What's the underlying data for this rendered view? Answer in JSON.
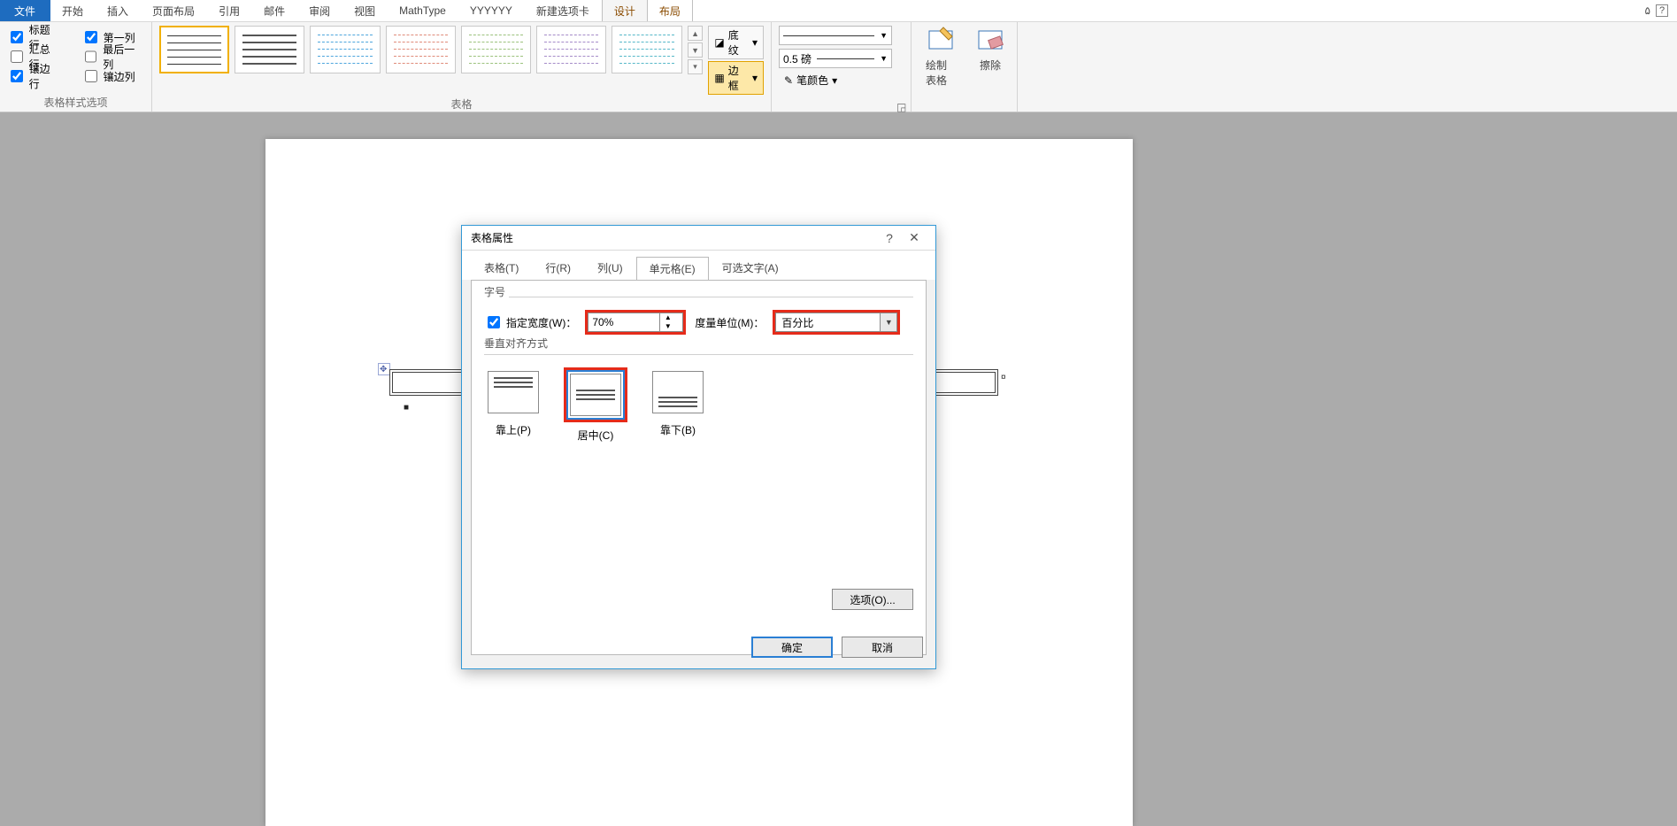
{
  "menu": {
    "file": "文件",
    "home": "开始",
    "insert": "插入",
    "layout": "页面布局",
    "ref": "引用",
    "mail": "邮件",
    "review": "审阅",
    "view": "视图",
    "math": "MathType",
    "y": "YYYYYY",
    "newtab": "新建选项卡",
    "design": "设计",
    "tlayout": "布局"
  },
  "styleopts": {
    "header_row": "标题行",
    "first_col": "第一列",
    "total_row": "汇总行",
    "last_col": "最后一列",
    "banded_row": "镶边行",
    "banded_col": "镶边列",
    "group_label": "表格样式选项"
  },
  "styles_group": "表格",
  "borders": {
    "shading": "底纹",
    "border": "边框"
  },
  "borders2": {
    "weight": "0.5 磅",
    "pencolor": "笔颜色"
  },
  "draw": {
    "draw": "绘制表格",
    "erase": "擦除"
  },
  "dialog": {
    "title": "表格属性",
    "help": "?",
    "close": "✕",
    "tabs": {
      "table": "表格(T)",
      "row": "行(R)",
      "col": "列(U)",
      "cell": "单元格(E)",
      "alt": "可选文字(A)"
    },
    "size_label": "字号",
    "pref_width": "指定宽度(W)：",
    "width_value": "70%",
    "unit_label": "度量单位(M)：",
    "unit_value": "百分比",
    "valign_label": "垂直对齐方式",
    "align": {
      "top": "靠上(P)",
      "center": "居中(C)",
      "bottom": "靠下(B)"
    },
    "options": "选项(O)...",
    "ok": "确定",
    "cancel": "取消"
  }
}
